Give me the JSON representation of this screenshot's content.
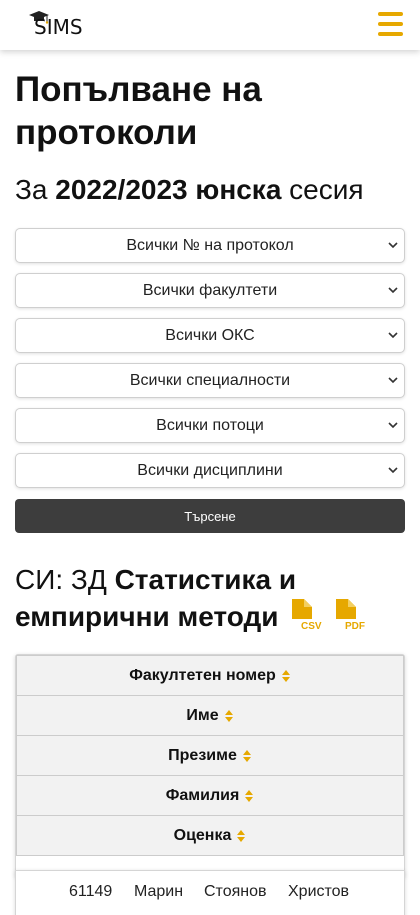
{
  "header": {
    "logo_text": "SIMS",
    "logo_icon": "graduation-cap-icon",
    "menu_icon": "hamburger-menu-icon",
    "accent_color": "#e6a800"
  },
  "page": {
    "title": "Попълване на протоколи",
    "session_prefix": "За",
    "session_year": "2022/2023 юнска",
    "session_suffix": "сесия"
  },
  "filters": {
    "protocol": "Всички № на протокол",
    "faculty": "Всички факултети",
    "degree": "Всички ОКС",
    "specialty": "Всички специалности",
    "stream": "Всички потоци",
    "discipline": "Всички дисциплини",
    "search_label": "Търсене"
  },
  "discipline": {
    "prefix": "СИ: ЗД",
    "name": "Статистика и емпирични методи",
    "export_icons": [
      "csv-file-icon",
      "pdf-file-icon"
    ]
  },
  "table": {
    "headers": [
      "Факултетен номер",
      "Име",
      "Презиме",
      "Фамилия",
      "Оценка"
    ],
    "rows": [
      {
        "faculty_number": "61149",
        "first_name": "Марин",
        "middle_name": "Стоянов",
        "last_name": "Христов"
      }
    ]
  }
}
